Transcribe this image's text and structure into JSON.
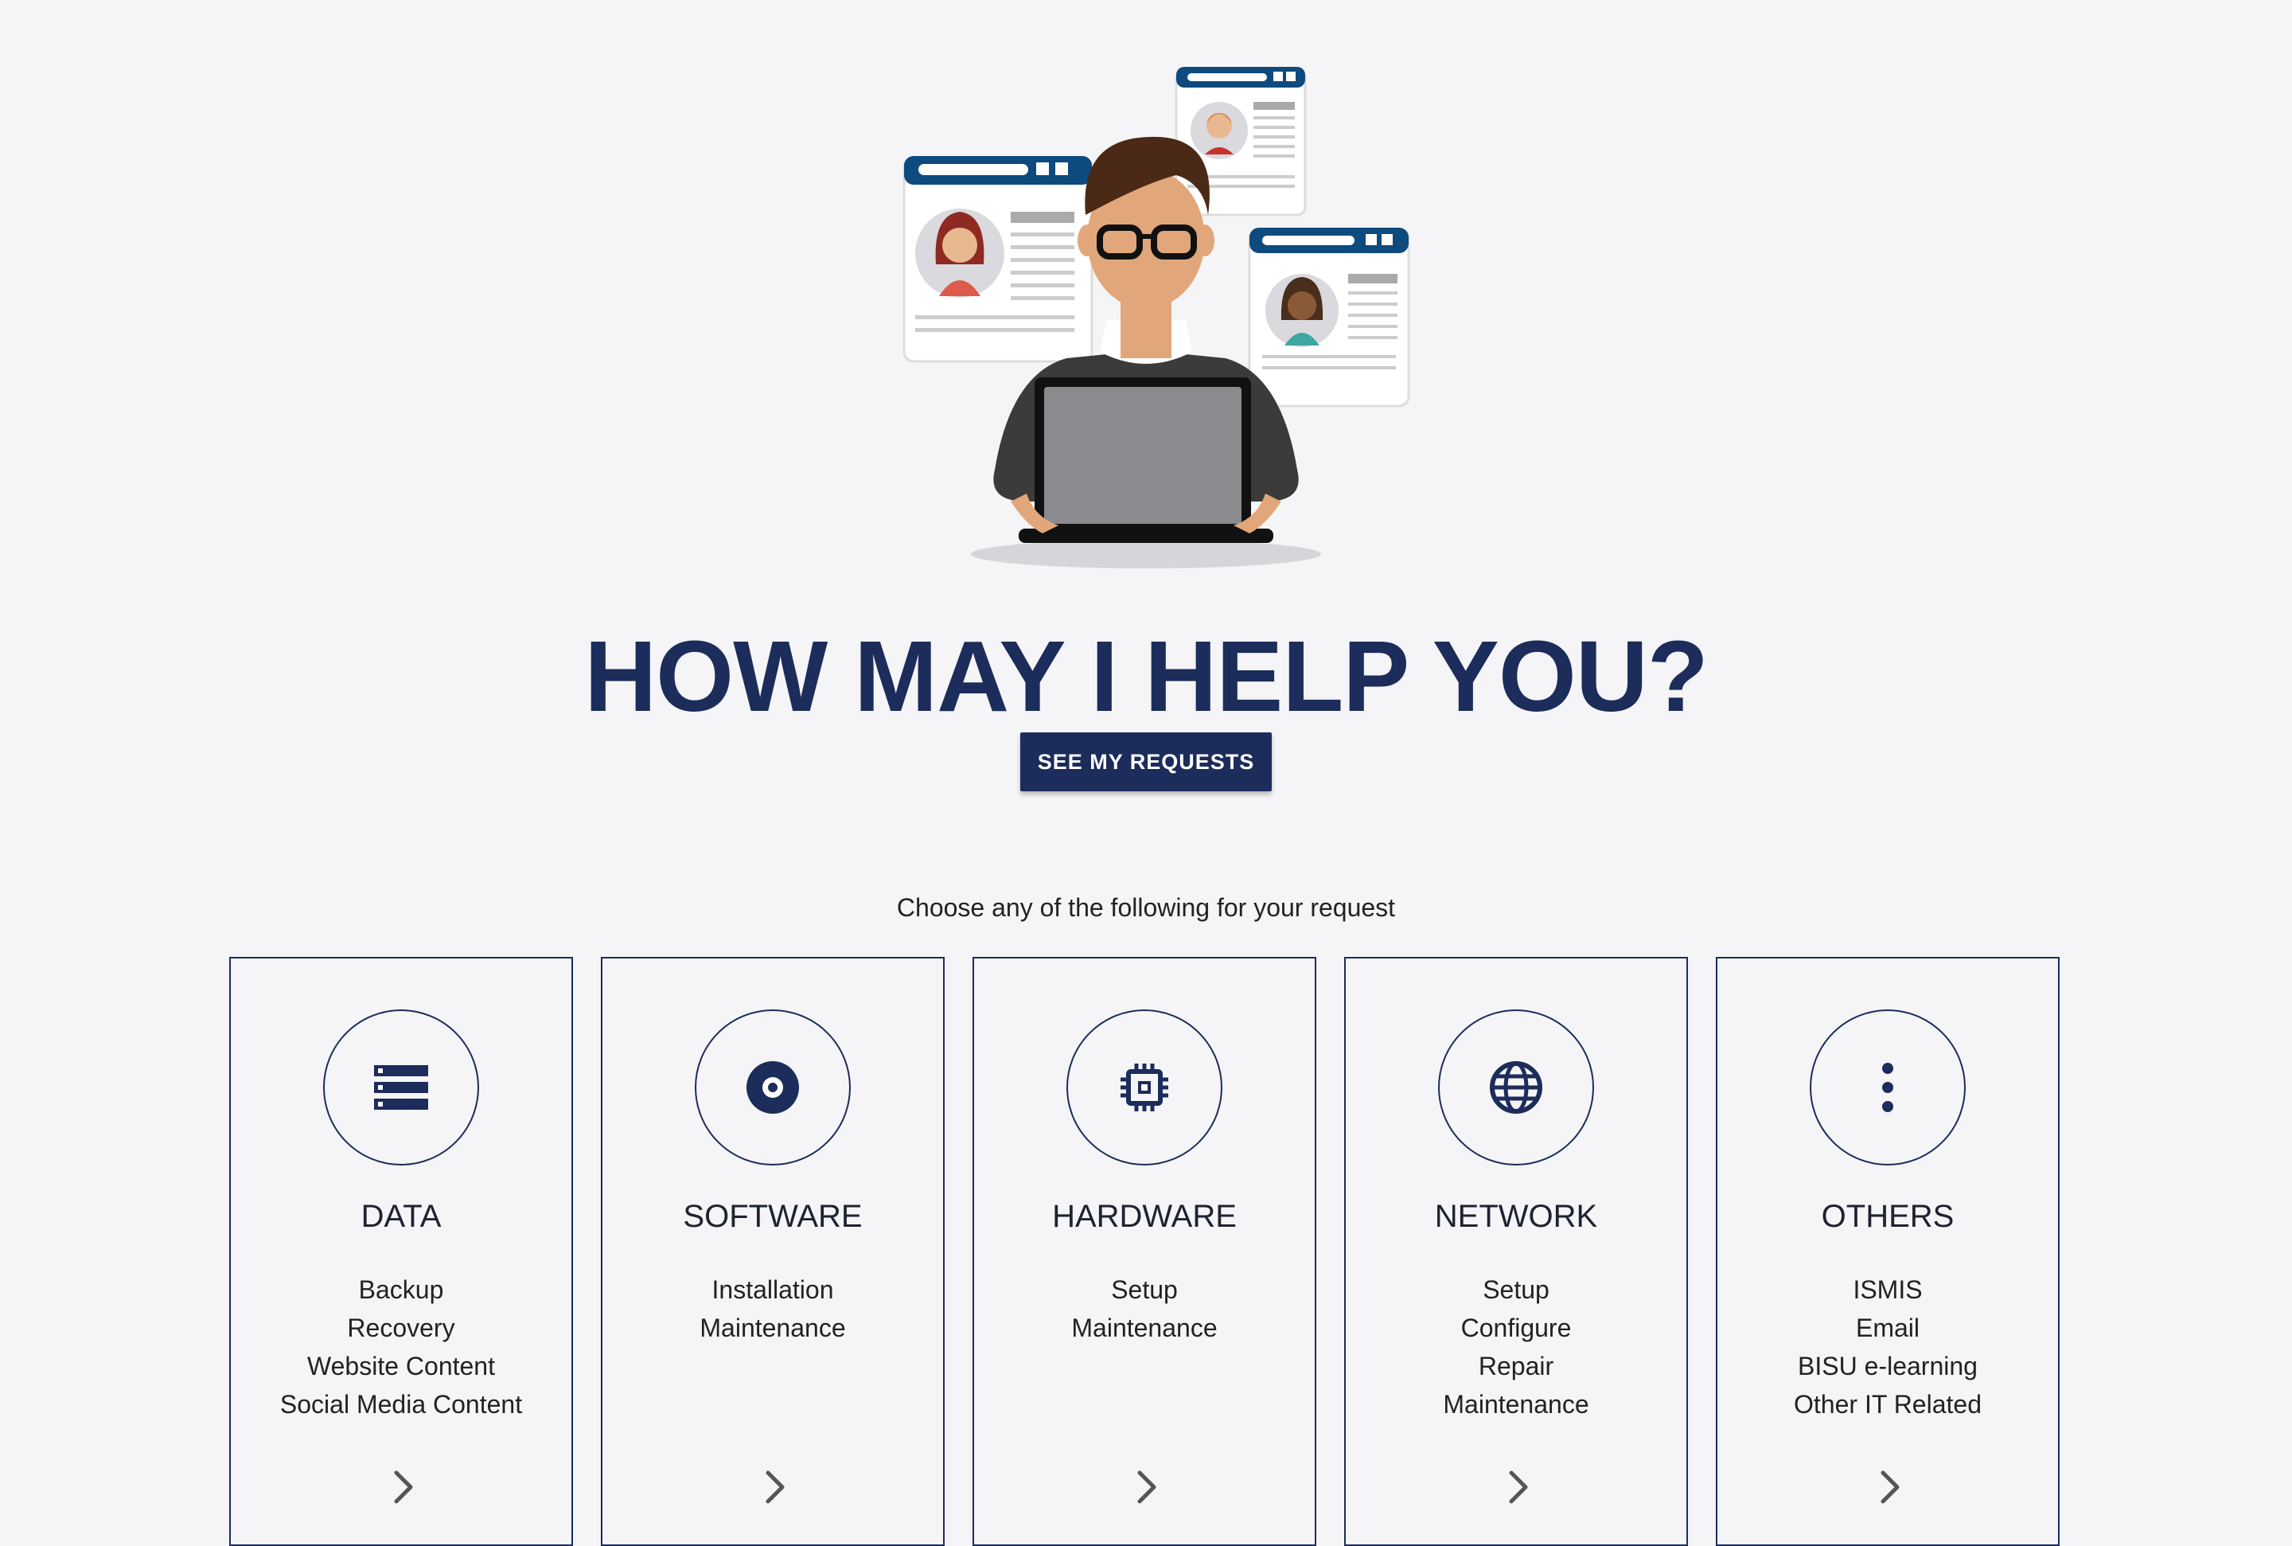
{
  "headline": "HOW MAY I HELP YOU?",
  "cta_label": "SEE MY REQUESTS",
  "subtitle": "Choose any of the following for your request",
  "colors": {
    "brand": "#1c2c5b",
    "background": "#f5f5f7"
  },
  "cards": [
    {
      "title": "DATA",
      "icon": "server-stack-icon",
      "items": [
        "Backup",
        "Recovery",
        "Website Content",
        "Social Media Content"
      ]
    },
    {
      "title": "SOFTWARE",
      "icon": "disc-icon",
      "items": [
        "Installation",
        "Maintenance"
      ]
    },
    {
      "title": "HARDWARE",
      "icon": "chip-icon",
      "items": [
        "Setup",
        "Maintenance"
      ]
    },
    {
      "title": "NETWORK",
      "icon": "globe-icon",
      "items": [
        "Setup",
        "Configure",
        "Repair",
        "Maintenance"
      ]
    },
    {
      "title": "OTHERS",
      "icon": "more-vertical-icon",
      "items": [
        "ISMIS",
        "Email",
        "BISU e-learning",
        "Other IT Related"
      ]
    }
  ]
}
